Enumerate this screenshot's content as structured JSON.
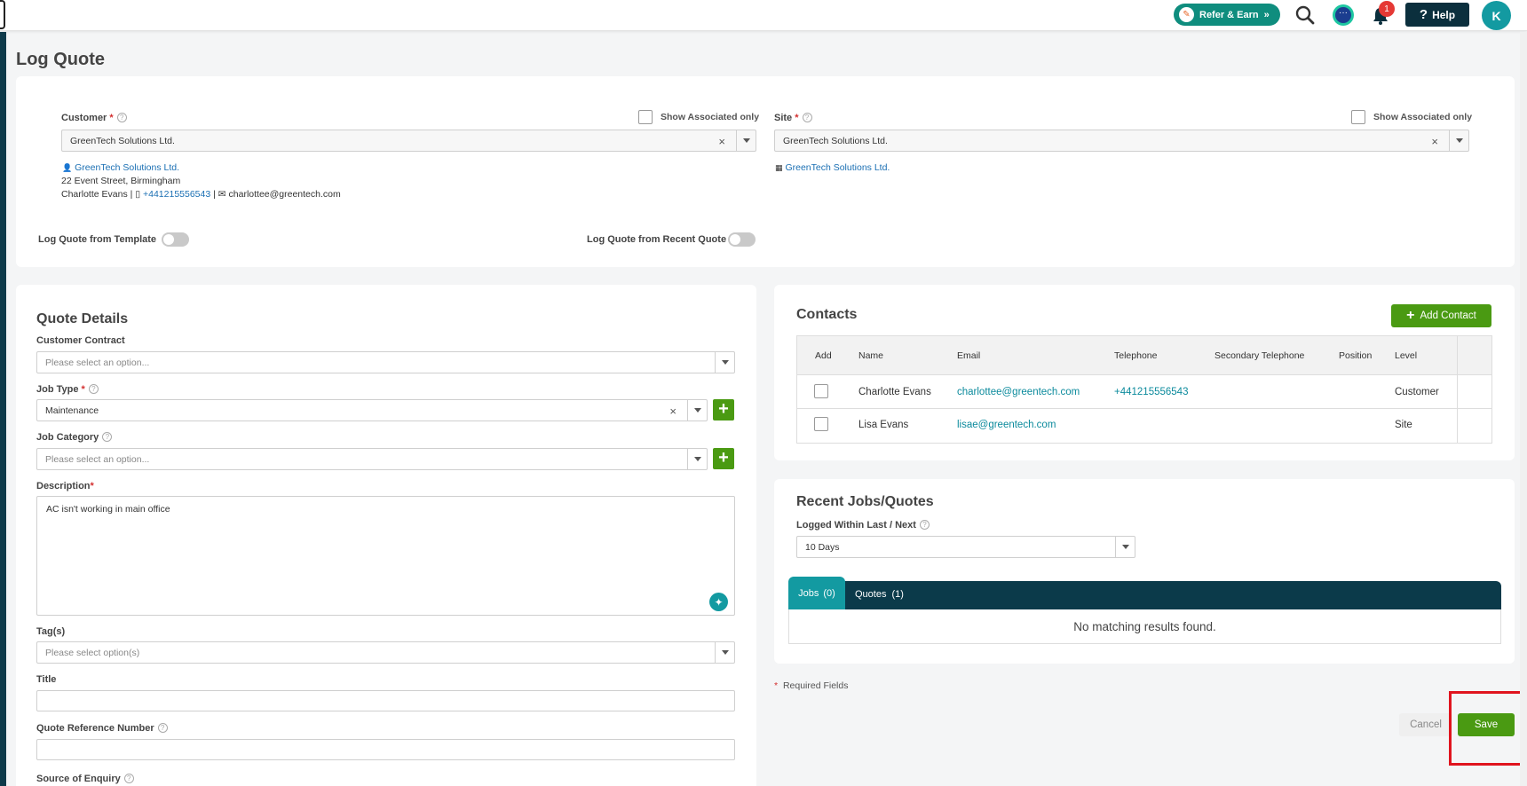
{
  "header": {
    "refer_label": "Refer & Earn",
    "help_label": "Help",
    "avatar_initial": "K",
    "notification_count": "1"
  },
  "page": {
    "title": "Log Quote"
  },
  "customer": {
    "label": "Customer",
    "show_associated": "Show Associated only",
    "value": "GreenTech Solutions Ltd.",
    "name_link": "GreenTech Solutions Ltd.",
    "address": "22 Event Street, Birmingham",
    "contact_name": "Charlotte Evans |",
    "phone": "+441215556543",
    "sep": "|",
    "email": "charlottee@greentech.com"
  },
  "site": {
    "label": "Site",
    "show_associated": "Show Associated only",
    "value": "GreenTech Solutions Ltd.",
    "name_link": "GreenTech Solutions Ltd."
  },
  "toggles": {
    "template_label": "Log Quote from Template",
    "recent_label": "Log Quote from Recent Quote"
  },
  "quote_details": {
    "title": "Quote Details",
    "contract_label": "Customer Contract",
    "contract_placeholder": "Please select an option...",
    "job_type_label": "Job Type",
    "job_type_value": "Maintenance",
    "job_category_label": "Job Category",
    "job_category_placeholder": "Please select an option...",
    "description_label": "Description",
    "description_value": "AC isn't working in main office",
    "tags_label": "Tag(s)",
    "tags_placeholder": "Please select option(s)",
    "title_label": "Title",
    "ref_label": "Quote Reference Number",
    "source_label": "Source of Enquiry"
  },
  "contacts": {
    "title": "Contacts",
    "add_button": "Add Contact",
    "columns": [
      "Add",
      "Name",
      "Email",
      "Telephone",
      "Secondary Telephone",
      "Position",
      "Level"
    ],
    "rows": [
      {
        "name": "Charlotte Evans",
        "email": "charlottee@greentech.com",
        "telephone": "+441215556543",
        "secondary": "",
        "position": "",
        "level": "Customer"
      },
      {
        "name": "Lisa Evans",
        "email": "lisae@greentech.com",
        "telephone": "",
        "secondary": "",
        "position": "",
        "level": "Site"
      }
    ]
  },
  "recent": {
    "title": "Recent Jobs/Quotes",
    "logged_label": "Logged Within Last / Next",
    "logged_value": "10 Days",
    "tab_jobs": "Jobs",
    "tab_jobs_count": "(0)",
    "tab_quotes": "Quotes",
    "tab_quotes_count": "(1)",
    "empty_message": "No matching results found."
  },
  "footer": {
    "required_note": "Required Fields",
    "required_star": "*",
    "cancel_label": "Cancel",
    "save_label": "Save"
  },
  "colors": {
    "primary_green": "#4a9a12",
    "teal": "#139aa1",
    "dark_navy": "#0b2f3d",
    "highlight_red": "#e0141e"
  },
  "icons": [
    "search-icon",
    "chat-icon",
    "bell-icon",
    "question-icon",
    "person-icon",
    "phone-icon",
    "mail-icon",
    "building-icon",
    "sparkle-icon",
    "plus-icon",
    "chevron-down-icon",
    "close-icon"
  ]
}
